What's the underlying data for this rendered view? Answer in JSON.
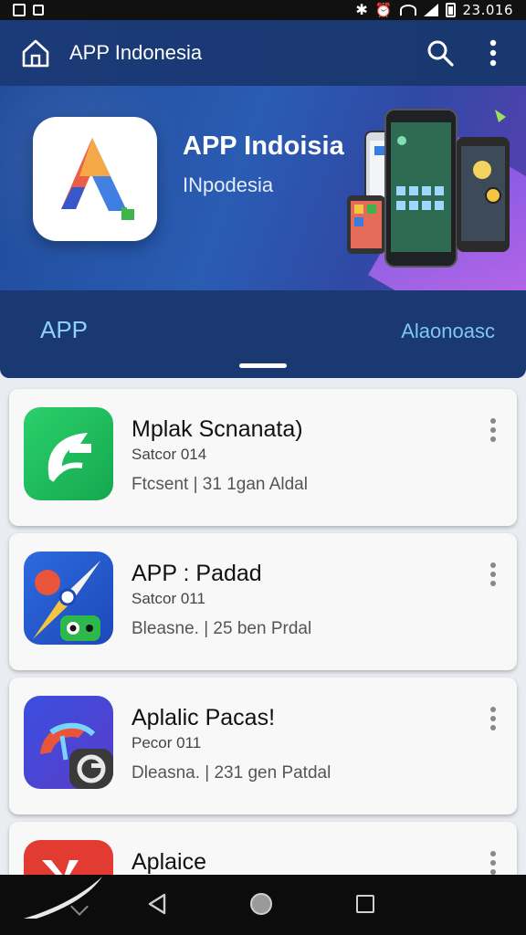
{
  "status_bar": {
    "time": "23.016"
  },
  "app_bar": {
    "title": "APP Indonesia"
  },
  "banner": {
    "title": "APP Indoisia",
    "subtitle": "INpodesia"
  },
  "tabs": {
    "left": "APP",
    "right": "Alaonoasc"
  },
  "apps": [
    {
      "title": "Mplak Scnanata)",
      "subtitle": "Satcor 014",
      "meta": "Ftcsent | 31 1gan Aldal",
      "icon": "leaf-app-icon"
    },
    {
      "title": "APP : Padad",
      "subtitle": "Satcor 011",
      "meta": "Bleasne. | 25 ben Prdal",
      "icon": "compass-app-icon"
    },
    {
      "title": "Aplalic Pacas!",
      "subtitle": "Pecor 011",
      "meta": "Dleasna. | 231 gen Patdal",
      "icon": "bird-app-icon"
    },
    {
      "title": "Aplaice",
      "subtitle": "",
      "meta": "",
      "icon": "red-app-icon"
    }
  ]
}
